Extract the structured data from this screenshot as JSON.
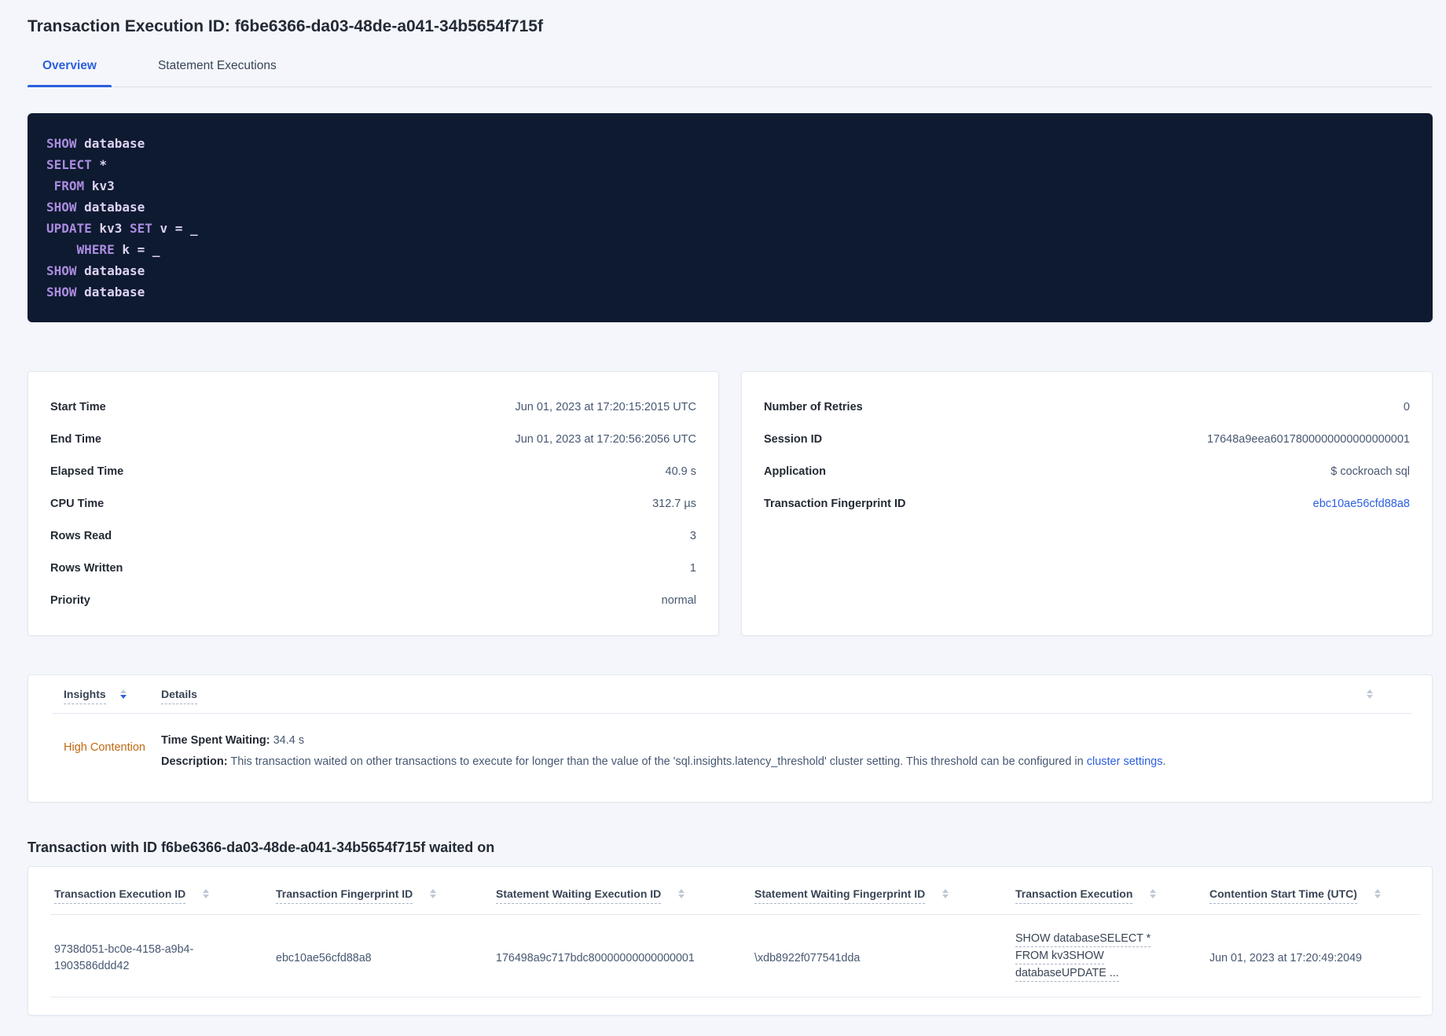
{
  "page": {
    "title": "Transaction Execution ID: f6be6366-da03-48de-a041-34b5654f715f"
  },
  "tabs": [
    {
      "label": "Overview",
      "active": true
    },
    {
      "label": "Statement Executions",
      "active": false
    }
  ],
  "sql_box": {
    "lines": [
      [
        {
          "t": "kw",
          "s": "SHOW"
        },
        {
          "t": "id",
          "s": " database"
        }
      ],
      [
        {
          "t": "kw",
          "s": "SELECT"
        },
        {
          "t": "id",
          "s": " *"
        }
      ],
      [
        {
          "t": "id",
          "s": " "
        },
        {
          "t": "kw",
          "s": "FROM"
        },
        {
          "t": "id",
          "s": " kv3"
        }
      ],
      [
        {
          "t": "kw",
          "s": "SHOW"
        },
        {
          "t": "id",
          "s": " database"
        }
      ],
      [
        {
          "t": "kw",
          "s": "UPDATE"
        },
        {
          "t": "id",
          "s": " kv3 "
        },
        {
          "t": "kw",
          "s": "SET"
        },
        {
          "t": "id",
          "s": " v = _"
        }
      ],
      [
        {
          "t": "id",
          "s": "    "
        },
        {
          "t": "kw",
          "s": "WHERE"
        },
        {
          "t": "id",
          "s": " k = _"
        }
      ],
      [
        {
          "t": "kw",
          "s": "SHOW"
        },
        {
          "t": "id",
          "s": " database"
        }
      ],
      [
        {
          "t": "kw",
          "s": "SHOW"
        },
        {
          "t": "id",
          "s": " database"
        }
      ]
    ]
  },
  "details_card": {
    "rows": [
      {
        "label": "Start Time",
        "value": "Jun 01, 2023 at 17:20:15:2015 UTC"
      },
      {
        "label": "End Time",
        "value": "Jun 01, 2023 at 17:20:56:2056 UTC"
      },
      {
        "label": "Elapsed Time",
        "value": "40.9 s"
      },
      {
        "label": "CPU Time",
        "value": "312.7 µs"
      },
      {
        "label": "Rows Read",
        "value": "3"
      },
      {
        "label": "Rows Written",
        "value": "1"
      },
      {
        "label": "Priority",
        "value": "normal"
      }
    ]
  },
  "meta_card": {
    "rows": [
      {
        "label": "Number of Retries",
        "value": "0"
      },
      {
        "label": "Session ID",
        "value": "17648a9eea6017800000000000000001"
      },
      {
        "label": "Application",
        "value": "$ cockroach sql"
      },
      {
        "label": "Transaction Fingerprint ID",
        "value": "ebc10ae56cfd88a8",
        "link": true
      }
    ]
  },
  "insights": {
    "col_insights": "Insights",
    "col_details": "Details",
    "row": {
      "insight": "High Contention",
      "waiting_label": "Time Spent Waiting:",
      "waiting_value": " 34.4 s",
      "desc_label": "Description:",
      "desc_text": " This transaction waited on other transactions to execute for longer than the value of the 'sql.insights.latency_threshold' cluster setting. This threshold can be configured in ",
      "desc_link": "cluster settings",
      "desc_suffix": "."
    }
  },
  "waited": {
    "heading": "Transaction with ID f6be6366-da03-48de-a041-34b5654f715f waited on",
    "columns": [
      "Transaction Execution ID",
      "Transaction Fingerprint ID",
      "Statement Waiting Execution ID",
      "Statement Waiting Fingerprint ID",
      "Transaction Execution",
      "Contention Start Time (UTC)"
    ],
    "row": {
      "transaction_execution_id": "9738d051-bc0e-4158-a9b4-1903586ddd42",
      "transaction_fingerprint_id": "ebc10ae56cfd88a8",
      "statement_waiting_execution_id": "176498a9c717bdc80000000000000001",
      "statement_waiting_fingerprint_id": "\\xdb8922f077541dda",
      "transaction_execution_lines": [
        "SHOW databaseSELECT *",
        "FROM kv3SHOW",
        "databaseUPDATE ..."
      ],
      "contention_start_time": "Jun 01, 2023 at 17:20:49:2049"
    }
  },
  "colors": {
    "accent_blue": "#2b5fe0",
    "insight_orange": "#c0680f",
    "sql_keyword_purple": "#ab8ce0",
    "sql_identifier_lavender": "#ddd3f2",
    "sql_box_background": "#0e1a30"
  }
}
